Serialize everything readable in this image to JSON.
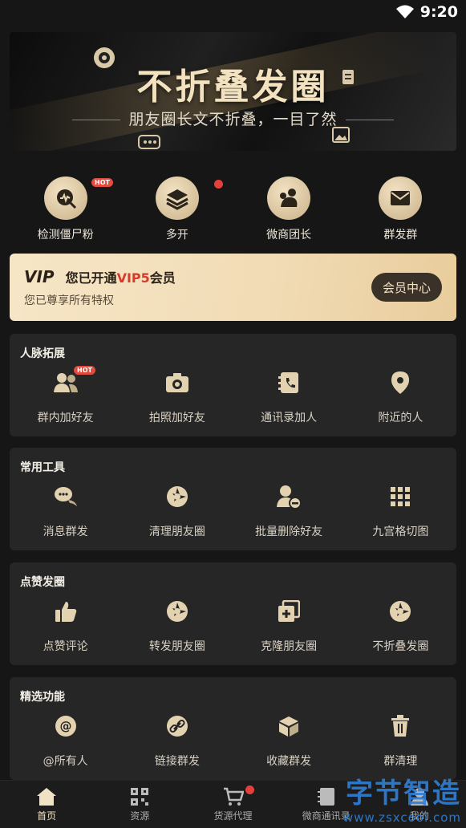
{
  "status": {
    "time": "9:20"
  },
  "banner": {
    "title": "不折叠发圈",
    "subtitle": "朋友圈长文不折叠，一目了然"
  },
  "quick": [
    {
      "label": "检测僵尸粉",
      "icon": "wave-search-icon",
      "badge": "HOT"
    },
    {
      "label": "多开",
      "icon": "layers-icon"
    },
    {
      "label": "微商团长",
      "icon": "team-icon"
    },
    {
      "label": "群发群",
      "icon": "mail-icon"
    }
  ],
  "vip": {
    "mark": "VIP",
    "status_prefix": "您已开通",
    "level": "VIP5",
    "status_suffix": "会员",
    "sub": "您已尊享所有特权",
    "button": "会员中心"
  },
  "sections": [
    {
      "title": "人脉拓展",
      "items": [
        {
          "label": "群内加好友",
          "icon": "group-users-icon",
          "badge": "HOT"
        },
        {
          "label": "拍照加好友",
          "icon": "camera-icon"
        },
        {
          "label": "通讯录加人",
          "icon": "contacts-phone-icon"
        },
        {
          "label": "附近的人",
          "icon": "location-pin-icon"
        }
      ]
    },
    {
      "title": "常用工具",
      "items": [
        {
          "label": "消息群发",
          "icon": "chat-bubbles-icon"
        },
        {
          "label": "清理朋友圈",
          "icon": "aperture-icon"
        },
        {
          "label": "批量删除好友",
          "icon": "user-remove-icon"
        },
        {
          "label": "九宫格切图",
          "icon": "grid-icon"
        }
      ]
    },
    {
      "title": "点赞发圈",
      "items": [
        {
          "label": "点赞评论",
          "icon": "thumbs-up-icon"
        },
        {
          "label": "转发朋友圈",
          "icon": "aperture-icon"
        },
        {
          "label": "克隆朋友圈",
          "icon": "clone-icon"
        },
        {
          "label": "不折叠发圈",
          "icon": "aperture-icon"
        }
      ]
    },
    {
      "title": "精选功能",
      "items": [
        {
          "label": "@所有人",
          "icon": "at-icon"
        },
        {
          "label": "链接群发",
          "icon": "link-icon"
        },
        {
          "label": "收藏群发",
          "icon": "box-icon"
        },
        {
          "label": "群清理",
          "icon": "trash-icon"
        }
      ]
    }
  ],
  "nav": [
    {
      "label": "首页",
      "icon": "home-icon",
      "active": true
    },
    {
      "label": "资源",
      "icon": "qrcode-icon"
    },
    {
      "label": "货源代理",
      "icon": "cart-icon"
    },
    {
      "label": "微商通讯录",
      "icon": "contacts-book-icon"
    },
    {
      "label": "我的",
      "icon": "user-icon"
    }
  ],
  "watermark": {
    "big": "字节智造",
    "small": "www.zsxcool.com"
  },
  "colors": {
    "gold": "#d9c7a1",
    "vip_level": "#d63a2b",
    "hot": "#e24b3d"
  }
}
